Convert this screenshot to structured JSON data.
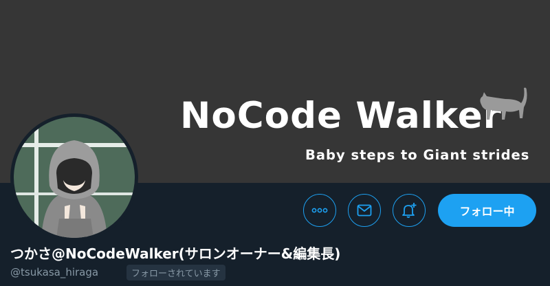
{
  "banner": {
    "title": "NoCode Walker",
    "subtitle": "Baby steps to Giant strides",
    "background_color": "#363636"
  },
  "avatar": {
    "description_icon": "hooded-figure-avatar"
  },
  "actions": {
    "more_icon": "more-dots-icon",
    "message_icon": "mail-icon",
    "notify_icon": "bell-plus-icon",
    "follow_label": "フォロー中",
    "accent_color": "#1da1f2"
  },
  "profile": {
    "display_name": "つかさ@NoCodeWalker(サロンオーナー&編集長)",
    "handle": "@tsukasa_hiraga",
    "follows_you": "フォローされています"
  }
}
